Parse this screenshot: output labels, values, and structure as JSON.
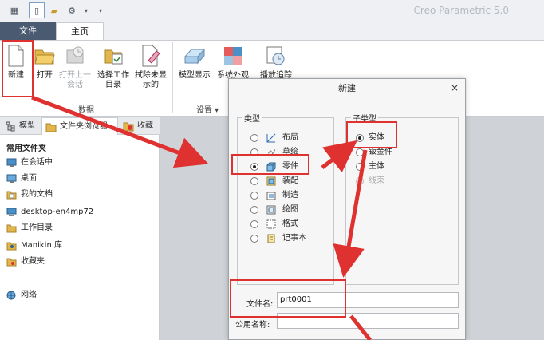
{
  "app": {
    "title": "Creo Parametric 5.0"
  },
  "quick_access": [
    {
      "icon": "new-file-icon"
    },
    {
      "icon": "open-folder-icon"
    },
    {
      "icon": "regenerate-icon"
    },
    {
      "icon": "dropdown-icon"
    }
  ],
  "tabs": [
    {
      "label": "文件"
    },
    {
      "label": "主页"
    }
  ],
  "ribbon": {
    "data_group": {
      "label": "数据",
      "buttons": [
        {
          "label": "新建",
          "icon": "new-file-icon"
        },
        {
          "label": "打开",
          "icon": "open-folder-icon"
        },
        {
          "label1": "打开上一",
          "label2": "会话",
          "icon": "open-last-session-icon"
        },
        {
          "label1": "选择工作",
          "label2": "目录",
          "icon": "select-working-dir-icon"
        },
        {
          "label1": "拭除未显",
          "label2": "示的",
          "icon": "erase-not-displayed-icon"
        }
      ]
    },
    "settings_group": {
      "label": "设置",
      "buttons": [
        {
          "label": "模型显示",
          "icon": "model-display-icon"
        },
        {
          "label": "系统外观",
          "icon": "system-appearance-icon"
        },
        {
          "label": "播放追踪",
          "icon": "play-trail-icon"
        }
      ]
    }
  },
  "navigator": {
    "tabs": [
      {
        "label": "模型"
      },
      {
        "label": "文件夹浏览器"
      },
      {
        "label": "收藏"
      }
    ],
    "heading": "常用文件夹",
    "items": [
      {
        "label": "在会话中",
        "icon": "in-session-icon"
      },
      {
        "label": "桌面",
        "icon": "desktop-icon"
      },
      {
        "label": "我的文档",
        "icon": "my-documents-icon"
      },
      {
        "label": "desktop-en4mp72",
        "icon": "computer-icon"
      },
      {
        "label": "工作目录",
        "icon": "working-directory-icon"
      },
      {
        "label": "Manikin 库",
        "icon": "manikin-library-icon"
      },
      {
        "label": "收藏夹",
        "icon": "favorites-icon"
      },
      {
        "label": "网络",
        "icon": "network-icon"
      }
    ]
  },
  "dialog": {
    "title": "新建",
    "close": "×",
    "type_label": "类型",
    "types": [
      {
        "label": "布局",
        "icon": "layout-icon"
      },
      {
        "label": "草绘",
        "icon": "sketch-icon"
      },
      {
        "label": "零件",
        "icon": "part-icon",
        "selected": true
      },
      {
        "label": "装配",
        "icon": "assembly-icon"
      },
      {
        "label": "制造",
        "icon": "manufacturing-icon"
      },
      {
        "label": "绘图",
        "icon": "drawing-icon"
      },
      {
        "label": "格式",
        "icon": "format-icon"
      },
      {
        "label": "记事本",
        "icon": "notebook-icon"
      }
    ],
    "subtype_label": "子类型",
    "subtypes": [
      {
        "label": "实体",
        "selected": true
      },
      {
        "label": "钣金件"
      },
      {
        "label": "主体"
      },
      {
        "label": "线束",
        "disabled": true
      }
    ],
    "filename_label": "文件名:",
    "filename_value": "prt0001",
    "common_name_label": "公用名称:",
    "common_name_value": ""
  },
  "colors": {
    "highlight": "#e03131",
    "file_tab": "#4a5a70"
  }
}
